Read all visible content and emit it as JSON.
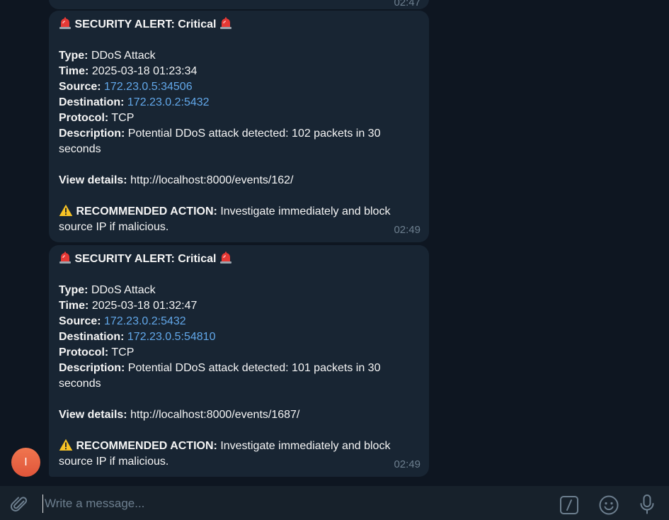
{
  "chat": {
    "previous_message": {
      "time": "02:47"
    },
    "messages": [
      {
        "title": "SECURITY ALERT: Critical",
        "type_label": "Type:",
        "type_value": "DDoS Attack",
        "time_label": "Time:",
        "time_value": "2025-03-18 01:23:34",
        "source_label": "Source:",
        "source_value": "172.23.0.5:34506",
        "destination_label": "Destination:",
        "destination_value": "172.23.0.2:5432",
        "protocol_label": "Protocol:",
        "protocol_value": "TCP",
        "description_label": "Description:",
        "description_value": "Potential DDoS attack detected: 102 packets in 30 seconds",
        "details_label": "View details:",
        "details_value": "http://localhost:8000/events/162/",
        "action_label": "RECOMMENDED ACTION:",
        "action_value": "Investigate immediately and block source IP if malicious.",
        "sent_time": "02:49"
      },
      {
        "title": "SECURITY ALERT: Critical",
        "type_label": "Type:",
        "type_value": "DDoS Attack",
        "time_label": "Time:",
        "time_value": "2025-03-18 01:32:47",
        "source_label": "Source:",
        "source_value": "172.23.0.2:5432",
        "destination_label": "Destination:",
        "destination_value": "172.23.0.5:54810",
        "protocol_label": "Protocol:",
        "protocol_value": "TCP",
        "description_label": "Description:",
        "description_value": "Potential DDoS attack detected: 101 packets in 30 seconds",
        "details_label": "View details:",
        "details_value": "http://localhost:8000/events/1687/",
        "action_label": "RECOMMENDED ACTION:",
        "action_value": "Investigate immediately and block source IP if malicious.",
        "sent_time": "02:49"
      }
    ],
    "sender_avatar": {
      "initial": "I",
      "color": "#e8623f"
    }
  },
  "composer": {
    "placeholder": "Write a message...",
    "icons": [
      "paperclip-icon",
      "bot-command-icon",
      "emoji-icon",
      "microphone-icon"
    ]
  },
  "icons": {
    "title_emoji": "siren-icon",
    "action_emoji": "warning-icon"
  },
  "colors": {
    "background": "#0e1621",
    "bubble": "#182533",
    "link": "#62a8ea",
    "timestamp": "#6d7f8f",
    "composer": "#17212b"
  }
}
